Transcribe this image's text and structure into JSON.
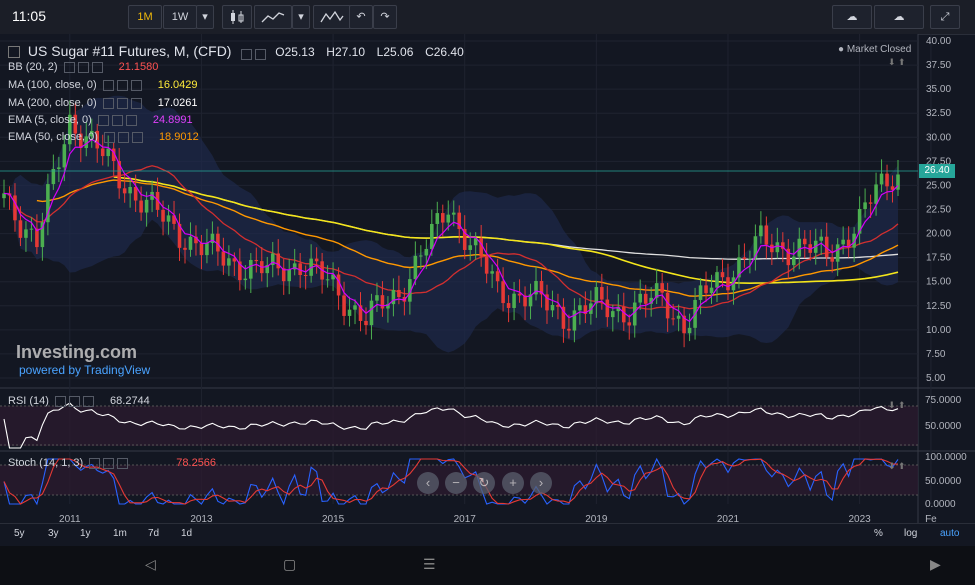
{
  "status_bar": {
    "time": "11:05"
  },
  "toolbar": {
    "intervals": [
      "1M",
      "1W"
    ],
    "active_interval": "1M"
  },
  "chart": {
    "title": "US Sugar #11 Futures, M, (CFD)",
    "ohlc": {
      "o_label": "O",
      "o": "25.13",
      "h_label": "H",
      "h": "27.10",
      "l_label": "L",
      "l": "25.06",
      "c_label": "C",
      "c": "26.40"
    },
    "market_status": "Market Closed",
    "watermark": "Investing.com",
    "powered_by": "powered by TradingView",
    "last_price": "26.40",
    "colors": {
      "up": "#26a69a",
      "down": "#ef5350",
      "candle_up": "#4caf50",
      "candle_down": "#e53935"
    }
  },
  "indicators": [
    {
      "label": "BB (20, 2)",
      "values": [
        "21.1580",
        "",
        ""
      ],
      "color": "#ff5252"
    },
    {
      "label": "MA (100, close, 0)",
      "values": [
        "16.0429"
      ],
      "color": "#ffeb3b"
    },
    {
      "label": "MA (200, close, 0)",
      "values": [
        "17.0261"
      ],
      "color": "#ffffff"
    },
    {
      "label": "EMA (5, close, 0)",
      "values": [
        "24.8991"
      ],
      "color": "#e040fb"
    },
    {
      "label": "EMA (50, close, 0)",
      "values": [
        "18.9012"
      ],
      "color": "#ff9800"
    }
  ],
  "rsi": {
    "label": "RSI (14)",
    "value": "68.2744",
    "axis": [
      "75.0000",
      "50.0000"
    ]
  },
  "stoch": {
    "label": "Stoch (14, 1, 3)",
    "value_d": "78.2566",
    "axis": [
      "100.0000",
      "50.0000",
      "0.0000"
    ]
  },
  "price_axis": [
    "40.00",
    "37.50",
    "35.00",
    "32.50",
    "30.00",
    "27.50",
    "25.00",
    "22.50",
    "20.00",
    "17.50",
    "15.00",
    "12.50",
    "10.00",
    "7.50",
    "5.00"
  ],
  "time_axis": [
    "2011",
    "2013",
    "2015",
    "2017",
    "2019",
    "2021",
    "2023",
    "Fe"
  ],
  "ranges": [
    "5y",
    "3y",
    "1y",
    "1m",
    "7d",
    "1d"
  ],
  "scale_options": [
    "%",
    "log",
    "auto"
  ],
  "chart_data": {
    "type": "line",
    "ylim": [
      5,
      40
    ],
    "x": [
      "2010-01",
      "2010-07",
      "2011-01",
      "2011-07",
      "2012-01",
      "2012-07",
      "2013-01",
      "2013-07",
      "2014-01",
      "2014-07",
      "2015-01",
      "2015-07",
      "2016-01",
      "2016-07",
      "2016-10",
      "2017-01",
      "2017-07",
      "2018-01",
      "2018-07",
      "2019-01",
      "2019-07",
      "2020-01",
      "2020-05",
      "2020-10",
      "2021-01",
      "2021-07",
      "2022-01",
      "2022-07",
      "2023-01",
      "2023-04",
      "2023-07"
    ],
    "series": [
      {
        "values": [
          24.0,
          19.0,
          32.0,
          28.0,
          24.0,
          21.0,
          18.5,
          17.0,
          16.0,
          17.0,
          14.5,
          11.0,
          14.0,
          19.5,
          23.0,
          20.0,
          14.0,
          13.5,
          11.5,
          12.5,
          12.0,
          13.5,
          10.5,
          14.5,
          16.0,
          19.0,
          18.5,
          18.0,
          21.0,
          24.5,
          26.4
        ]
      }
    ]
  }
}
